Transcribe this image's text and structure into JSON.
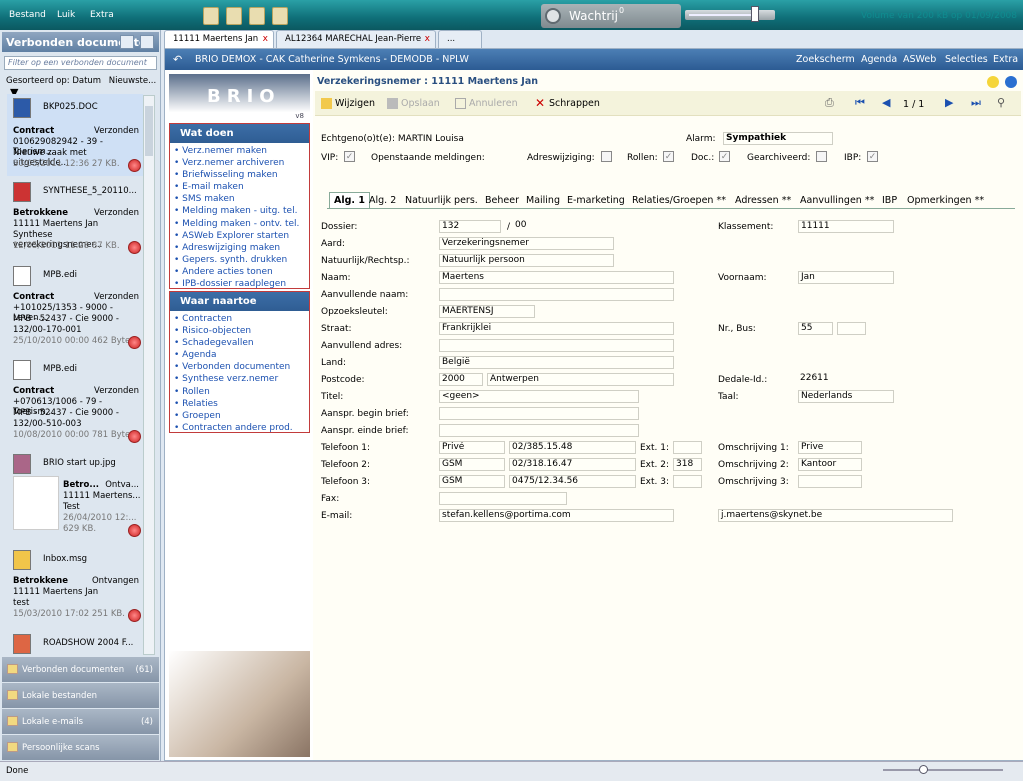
{
  "app": {
    "menu": [
      "Bestand",
      "Luik",
      "Extra"
    ],
    "queue_label": "Wachtrij",
    "queue_count": "0",
    "volume_text": "Volume van 200 kB op 01/09/2008",
    "status": "Done"
  },
  "left": {
    "title": "Verbonden documenten",
    "filter_placeholder": "Filter op een verbonden document",
    "sort_label": "Gesorteerd op: Datum",
    "sort_dir": "Nieuwste...",
    "docs": [
      {
        "file": "BKP025.DOC",
        "l1": "Contract",
        "l1r": "Verzonden",
        "l2": "010629082942 - 39 - Toerism...",
        "l3": "Nieuwe zaak met uitgestelde...",
        "meta": "30/05/2011 12:36  27 KB."
      },
      {
        "file": "SYNTHESE_5_20110...",
        "l1": "Betrokkene",
        "l1r": "Verzonden",
        "l2": "11111 Maertens Jan",
        "l3": "Synthese verzekeringsnemer...",
        "meta": "12/05/2011 11:28  87 KB."
      },
      {
        "file": "MPB.edi",
        "l1": "Contract",
        "l1r": "Verzonden",
        "l2": "+101025/1353 - 9000 - Leven...",
        "l3": "MPB - 52437 - Cie 9000 -",
        "l4": "132/00-170-001",
        "meta": "25/10/2010 00:00  462 Bytes"
      },
      {
        "file": "MPB.edi",
        "l1": "Contract",
        "l1r": "Verzonden",
        "l2": "+070613/1006 - 79 - Toerism...",
        "l3": "MPB - 52437 - Cie 9000 -",
        "l4": "132/00-510-003",
        "meta": "10/08/2010 00:00  781 Bytes"
      },
      {
        "file": "BRIO start up.jpg",
        "l1": "Betro...",
        "l1r": "Ontva...",
        "l2": "11111 Maertens...",
        "l3": "Test",
        "meta": "26/04/2010 12:...",
        "l4": "629 KB."
      },
      {
        "file": "Inbox.msg",
        "l1": "Betrokkene",
        "l1r": "Ontvangen",
        "l2": "11111 Maertens Jan",
        "l3": "test",
        "meta": "15/03/2010 17:02  251 KB."
      },
      {
        "file": "ROADSHOW 2004 F..."
      }
    ],
    "nav": [
      {
        "label": "Verbonden documenten",
        "count": "(61)"
      },
      {
        "label": "Lokale bestanden",
        "count": ""
      },
      {
        "label": "Lokale e-mails",
        "count": "(4)"
      },
      {
        "label": "Persoonlijke scans",
        "count": ""
      }
    ]
  },
  "tabs": [
    {
      "label": "11111 Maertens Jan"
    },
    {
      "label": "AL12364 MARECHAL Jean-Pierre"
    },
    {
      "label": "..."
    }
  ],
  "header": {
    "title": "BRIO DEMOX - CAK Catherine Symkens - DEMODB - NPLW",
    "links": [
      "Zoekscherm",
      "Agenda",
      "ASWeb",
      "Selecties",
      "Extra"
    ]
  },
  "sidebar": {
    "logo": "BRIO",
    "version": "v8",
    "wat_doen_title": "Wat doen",
    "wat_doen": [
      "Verz.nemer maken",
      "Verz.nemer archiveren",
      "Briefwisseling maken",
      "E-mail maken",
      "SMS maken",
      "Melding maken - uitg. tel.",
      "Melding maken - ontv. tel.",
      "ASWeb Explorer starten",
      "Adreswijziging maken",
      "Gepers. synth. drukken",
      "Andere acties tonen",
      "IPB-dossier raadplegen"
    ],
    "waar_title": "Waar naartoe",
    "waar": [
      "Contracten",
      "Risico-objecten",
      "Schadegevallen",
      "Agenda",
      "Verbonden documenten",
      "Synthese verz.nemer",
      "Rollen",
      "Relaties",
      "Groepen",
      "Contracten andere prod."
    ]
  },
  "form": {
    "title": "Verzekeringsnemer : 11111 Maertens Jan",
    "toolbar": {
      "edit": "Wijzigen",
      "save": "Opslaan",
      "cancel": "Annuleren",
      "delete": "Schrappen",
      "page": "1 / 1"
    },
    "echtgenoot": "Echtgeno(o)t(e): MARTIN Louisa",
    "alarm_label": "Alarm:",
    "alarm": "Sympathiek",
    "flags": {
      "vip": "VIP:",
      "meld": "Openstaande meldingen:",
      "adres": "Adreswijziging:",
      "rollen": "Rollen:",
      "doc": "Doc.:",
      "gearch": "Gearchiveerd:",
      "ibp": "IBP:"
    },
    "subtabs": [
      "Alg. 1",
      "Alg. 2",
      "Natuurlijk pers.",
      "Beheer",
      "Mailing",
      "E-marketing",
      "Relaties/Groepen **",
      "Adressen **",
      "Aanvullingen **",
      "IBP",
      "Opmerkingen **"
    ],
    "labels": {
      "dossier": "Dossier:",
      "aard": "Aard:",
      "natuurlijk": "Natuurlijk/Rechtsp.:",
      "naam": "Naam:",
      "aanv_naam": "Aanvullende naam:",
      "opzoek": "Opzoeksleutel:",
      "straat": "Straat:",
      "aanv_adres": "Aanvullend adres:",
      "land": "Land:",
      "postcode": "Postcode:",
      "titel": "Titel:",
      "begin": "Aanspr. begin brief:",
      "einde": "Aanspr. einde brief:",
      "tel1": "Telefoon 1:",
      "tel2": "Telefoon 2:",
      "tel3": "Telefoon 3:",
      "fax": "Fax:",
      "email": "E-mail:",
      "klassement": "Klassement:",
      "voornaam": "Voornaam:",
      "nrbus": "Nr., Bus:",
      "dedale": "Dedale-Id.:",
      "taal": "Taal:",
      "ext1": "Ext. 1:",
      "ext2": "Ext. 2:",
      "ext3": "Ext. 3:",
      "oms1": "Omschrijving 1:",
      "oms2": "Omschrijving 2:",
      "oms3": "Omschrijving 3:",
      "slash": "/"
    },
    "values": {
      "dossier": "132",
      "dossier2": "00",
      "aard": "Verzekeringsnemer",
      "natuurlijk": "Natuurlijk persoon",
      "naam": "Maertens",
      "opzoek": "MAERTENSJ",
      "straat": "Frankrijklei",
      "land": "België",
      "postcode": "2000",
      "gemeente": "Antwerpen",
      "titel": "<geen>",
      "tel1_type": "Privé",
      "tel1": "02/385.15.48",
      "tel2_type": "GSM",
      "tel2": "02/318.16.47",
      "tel3_type": "GSM",
      "tel3": "0475/12.34.56",
      "email": "stefan.kellens@portima.com",
      "klassement": "11111",
      "voornaam": "Jan",
      "nr": "55",
      "dedale": "22611",
      "taal": "Nederlands",
      "ext2": "318",
      "oms1": "Prive",
      "oms2": "Kantoor",
      "email2": "j.maertens@skynet.be"
    }
  }
}
